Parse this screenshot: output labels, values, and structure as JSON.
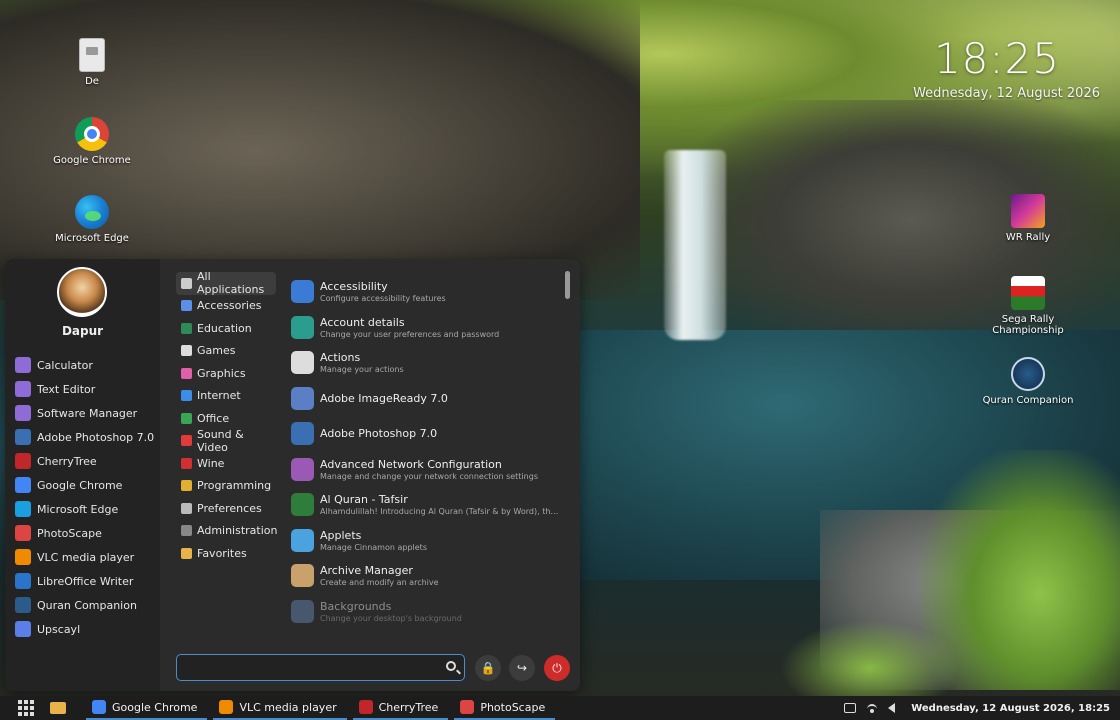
{
  "clock": {
    "time": "18:25",
    "date": "Wednesday, 12 August 2026"
  },
  "desktop_icons": [
    {
      "label": "De"
    },
    {
      "label": "Google Chrome"
    },
    {
      "label": "Microsoft Edge"
    },
    {
      "label": "WR Rally"
    },
    {
      "label": "Sega Rally Championship"
    },
    {
      "label": "Quran Companion"
    }
  ],
  "menu": {
    "user": {
      "name": "Dapur"
    },
    "favorites": [
      {
        "label": "Calculator",
        "icon": "calculator-icon",
        "color": "#8e6bd6"
      },
      {
        "label": "Text Editor",
        "icon": "text-editor-icon",
        "color": "#8e6bd6"
      },
      {
        "label": "Software Manager",
        "icon": "software-manager-icon",
        "color": "#8e6bd6"
      },
      {
        "label": "Adobe Photoshop 7.0",
        "icon": "photoshop-icon",
        "color": "#3a6fb3"
      },
      {
        "label": "CherryTree",
        "icon": "cherrytree-icon",
        "color": "#c0262a"
      },
      {
        "label": "Google Chrome",
        "icon": "chrome-icon",
        "color": "#4285f4"
      },
      {
        "label": "Microsoft Edge",
        "icon": "edge-icon",
        "color": "#1a9fe0"
      },
      {
        "label": "PhotoScape",
        "icon": "photoscape-icon",
        "color": "#d44"
      },
      {
        "label": "VLC media player",
        "icon": "vlc-icon",
        "color": "#f08a00"
      },
      {
        "label": "LibreOffice Writer",
        "icon": "writer-icon",
        "color": "#2a74c9"
      },
      {
        "label": "Quran Companion",
        "icon": "quran-icon",
        "color": "#2a5b8a"
      },
      {
        "label": "Upscayl",
        "icon": "upscayl-icon",
        "color": "#5b7fe8"
      }
    ],
    "categories": [
      {
        "label": "All Applications",
        "icon": "grid-icon",
        "color": "#cccccc",
        "active": true
      },
      {
        "label": "Accessories",
        "icon": "accessories-icon",
        "color": "#5b8fe8"
      },
      {
        "label": "Education",
        "icon": "education-icon",
        "color": "#2e8b57"
      },
      {
        "label": "Games",
        "icon": "games-icon",
        "color": "#dddddd"
      },
      {
        "label": "Graphics",
        "icon": "graphics-icon",
        "color": "#e05fa8"
      },
      {
        "label": "Internet",
        "icon": "internet-icon",
        "color": "#3a8ee6"
      },
      {
        "label": "Office",
        "icon": "office-icon",
        "color": "#3aa655"
      },
      {
        "label": "Sound & Video",
        "icon": "sound-video-icon",
        "color": "#e03a3a"
      },
      {
        "label": "Wine",
        "icon": "wine-icon",
        "color": "#d03030"
      },
      {
        "label": "Programming",
        "icon": "programming-icon",
        "color": "#e0b030"
      },
      {
        "label": "Preferences",
        "icon": "preferences-icon",
        "color": "#bbbbbb"
      },
      {
        "label": "Administration",
        "icon": "administration-icon",
        "color": "#888888"
      },
      {
        "label": "Favorites",
        "icon": "favorites-icon",
        "color": "#e8b34a"
      }
    ],
    "apps": [
      {
        "name": "Accessibility",
        "desc": "Configure accessibility features",
        "icon": "accessibility-icon",
        "color": "#3a7bd5"
      },
      {
        "name": "Account details",
        "desc": "Change your user preferences and password",
        "icon": "account-icon",
        "color": "#2a9d8f"
      },
      {
        "name": "Actions",
        "desc": "Manage your actions",
        "icon": "actions-icon",
        "color": "#dddddd"
      },
      {
        "name": "Adobe ImageReady 7.0",
        "desc": "",
        "icon": "imageready-icon",
        "color": "#5a7fc4"
      },
      {
        "name": "Adobe Photoshop 7.0",
        "desc": "",
        "icon": "photoshop-icon",
        "color": "#3a6fb3"
      },
      {
        "name": "Advanced Network Configuration",
        "desc": "Manage and change your network connection settings",
        "icon": "network-icon",
        "color": "#9b59b6"
      },
      {
        "name": "Al Quran - Tafsir",
        "desc": "Alhamdulillah! Introducing Al Quran (Tafsir & by Word), the ...",
        "icon": "quran-tafsir-icon",
        "color": "#2f7d3a"
      },
      {
        "name": "Applets",
        "desc": "Manage Cinnamon applets",
        "icon": "applets-icon",
        "color": "#4aa3df"
      },
      {
        "name": "Archive Manager",
        "desc": "Create and modify an archive",
        "icon": "archive-icon",
        "color": "#c9a26b"
      },
      {
        "name": "Backgrounds",
        "desc": "Change your desktop's background",
        "icon": "backgrounds-icon",
        "color": "#6a8fbf",
        "faded": true
      }
    ],
    "search": {
      "value": "",
      "placeholder": ""
    }
  },
  "taskbar": {
    "tasks": [
      {
        "label": "Google Chrome",
        "icon": "chrome-icon",
        "color": "#4285f4"
      },
      {
        "label": "VLC media player",
        "icon": "vlc-icon",
        "color": "#f08a00"
      },
      {
        "label": "CherryTree",
        "icon": "cherrytree-icon",
        "color": "#c0262a"
      },
      {
        "label": "PhotoScape",
        "icon": "photoscape-icon",
        "color": "#d44"
      }
    ],
    "datetime": "Wednesday, 12 August 2026, 18:25"
  }
}
